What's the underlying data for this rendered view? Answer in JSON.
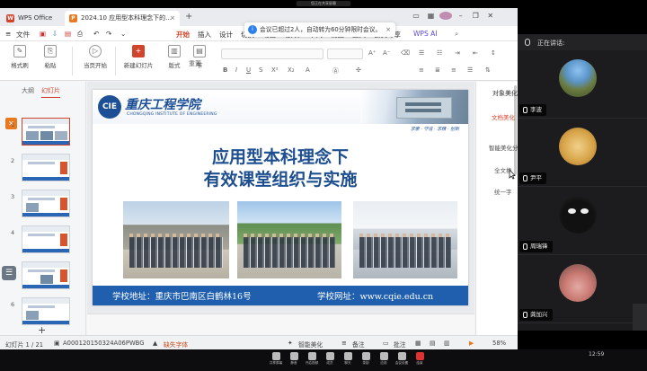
{
  "meeting": {
    "top_pill": "您正在共享屏幕"
  },
  "titlebar": {
    "wps_tab": "WPS Office",
    "doc_tab": "2024.10 应用型本科理念下的…",
    "close": "×",
    "add": "+"
  },
  "toast": {
    "message": "会议已超过2人，自动转为60分钟限时会议。",
    "close": "×"
  },
  "menu": {
    "file": "文件",
    "items": [
      "开始",
      "插入",
      "设计",
      "切换",
      "动画",
      "放映",
      "审阅",
      "视图",
      "工具",
      "会员专享",
      "WPS AI"
    ]
  },
  "toolbar": {
    "format_painter": "格式刷",
    "paste": "粘贴",
    "from_current": "当页开始",
    "new_slide": "新建幻灯片",
    "layout": "版式",
    "section": "节",
    "reset": "重置"
  },
  "left_panel": {
    "outline_tab": "大纲",
    "slides_tab": "幻灯片",
    "slide_numbers": [
      "1",
      "2",
      "3",
      "4",
      "5",
      "6"
    ],
    "add": "+"
  },
  "slide": {
    "school_name": "重庆工程学院",
    "school_en": "CHONGQING INSTITUTE OF ENGINEERING",
    "motto": "求索 · 守信 · 求精 · 创新",
    "logo_text": "CIE",
    "title_line1": "应用型本科理念下",
    "title_line2": "有效课堂组织与实施",
    "footer_address": "学校地址：重庆市巴南区白鹤林16号",
    "footer_website": "学校网址：www.cqie.edu.cn"
  },
  "right_panel": {
    "title": "对象美化",
    "tab": "文档美化",
    "section": "智能美化分",
    "option1": "全文换",
    "option2": "统一字"
  },
  "statusbar": {
    "slide_counter": "幻灯片 1 / 21",
    "doc_id": "A000120150324A06PWBG",
    "missing_fonts": "缺失字体",
    "smart_beautify": "智能美化",
    "notes": "备注",
    "comments": "批注",
    "zoom": "58%"
  },
  "participants": {
    "header": "正在讲话:",
    "people": [
      "李波",
      "尹平",
      "周瑞锋",
      "龚加兴"
    ]
  },
  "taskbar": {
    "items": [
      "共享屏幕",
      "静音",
      "开启视频",
      "成员",
      "聊天",
      "录制",
      "应用",
      "会议设置",
      "结束"
    ],
    "clock": "12:59"
  },
  "colors": {
    "accent": "#d0442c",
    "slide_blue": "#1f5fae",
    "title_blue": "#1d4e8f"
  }
}
